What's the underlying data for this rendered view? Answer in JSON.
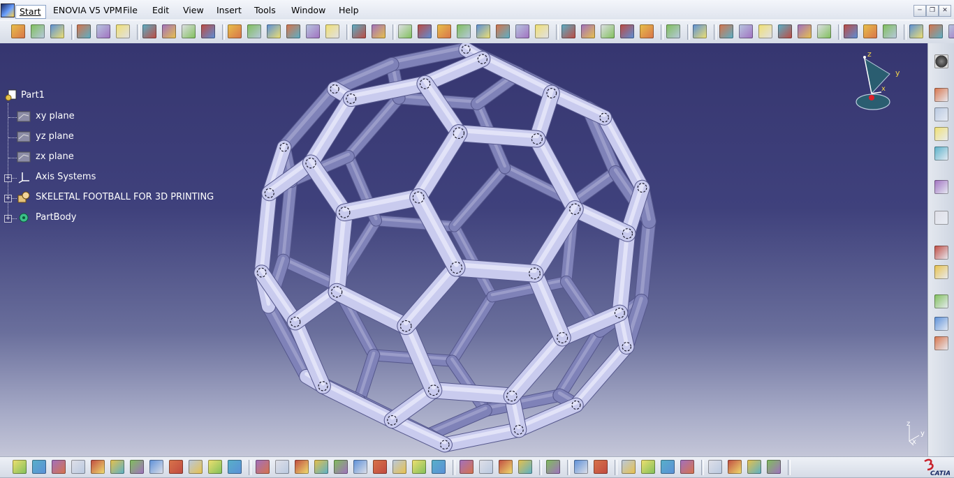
{
  "menubar": {
    "start": "Start",
    "items": [
      "ENOVIA V5 VPM",
      "File",
      "Edit",
      "View",
      "Insert",
      "Tools",
      "Window",
      "Help"
    ]
  },
  "window_controls": [
    "minimize-icon",
    "restore-icon",
    "close-icon"
  ],
  "tree": {
    "root": "Part1",
    "nodes": [
      {
        "label": "xy plane",
        "icon": "plane-icon"
      },
      {
        "label": "yz plane",
        "icon": "plane-icon"
      },
      {
        "label": "zx plane",
        "icon": "plane-icon"
      },
      {
        "label": "Axis Systems",
        "icon": "axis-system-icon"
      },
      {
        "label": "SKELETAL FOOTBALL FOR 3D PRINTING",
        "icon": "geometrical-set-icon"
      },
      {
        "label": "PartBody",
        "icon": "part-body-icon"
      }
    ]
  },
  "compass": {
    "x": "x",
    "y": "y",
    "z": "z"
  },
  "mini_axis": {
    "x": "x",
    "y": "y",
    "z": "z"
  },
  "brand": {
    "logo_text": "CATIA"
  },
  "colors": {
    "viewport_top": "#363670",
    "viewport_bottom": "#c4c6d8",
    "model": "#c9cbee",
    "model_shadow": "#7f82b8",
    "tree_text": "#ffffff"
  }
}
